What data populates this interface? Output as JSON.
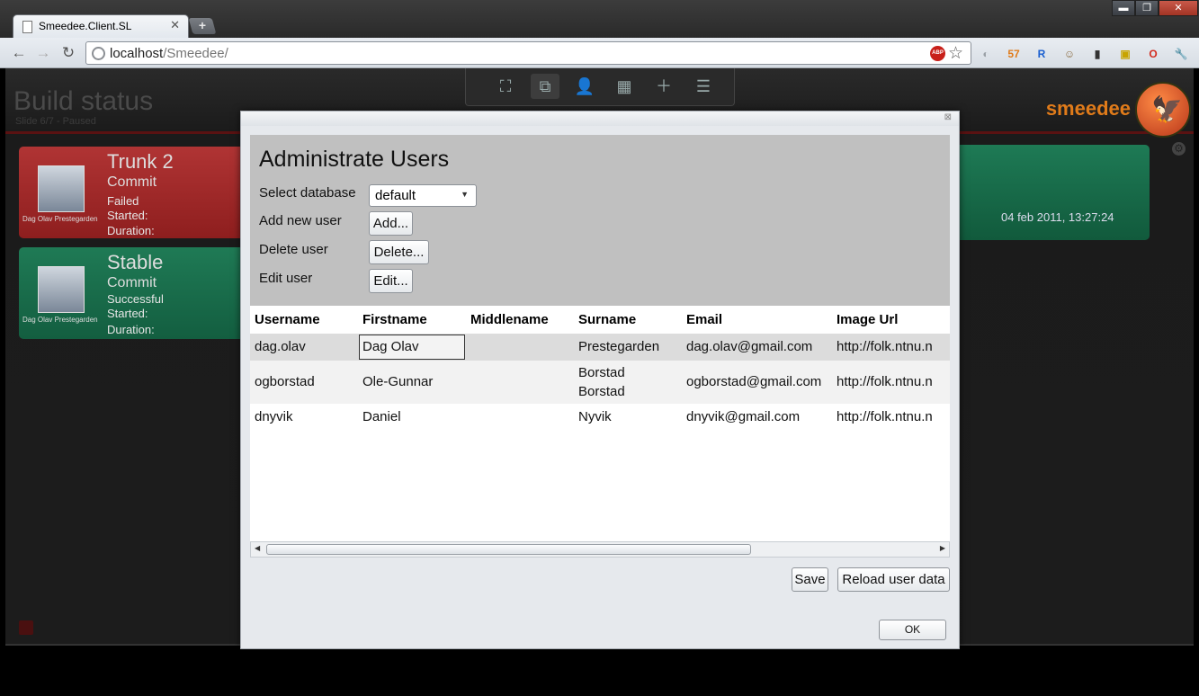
{
  "browser": {
    "tab_title": "Smeedee.Client.SL",
    "tab_close": "✕",
    "new_tab": "+",
    "window_controls": {
      "minimize": "▬",
      "maximize": "❐",
      "close": "✕"
    },
    "nav": {
      "back": "←",
      "forward": "→",
      "reload": "↻"
    },
    "url_host": "localhost",
    "url_path": "/Smeedee/",
    "abp_label": "ABP",
    "star": "☆",
    "extensions": [
      {
        "name": "search-ext-icon",
        "glyph": "◐",
        "color": "#9aa0a6"
      },
      {
        "name": "calendar-ext-icon",
        "glyph": "57",
        "color": "#e07b1a"
      },
      {
        "name": "r-ext-icon",
        "glyph": "R",
        "color": "#1a5fd0"
      },
      {
        "name": "owl-ext-icon",
        "glyph": "☺",
        "color": "#8a6a40"
      },
      {
        "name": "phone-ext-icon",
        "glyph": "▮",
        "color": "#333"
      },
      {
        "name": "sab-ext-icon",
        "glyph": "▣",
        "color": "#c8a400"
      },
      {
        "name": "opera-ext-icon",
        "glyph": "O",
        "color": "#d32b1e"
      },
      {
        "name": "wrench-icon",
        "glyph": "🔧",
        "color": "#555"
      }
    ]
  },
  "app": {
    "title": "Build status",
    "subtitle": "Slide 6/7 - Paused",
    "logo_text": "smeedee",
    "toolbar_icons": [
      {
        "name": "fullscreen-icon",
        "glyph": "⛶"
      },
      {
        "name": "settings-slider-icon",
        "glyph": "⧉"
      },
      {
        "name": "user-add-icon",
        "glyph": "👤"
      },
      {
        "name": "calendar-icon",
        "glyph": "▦"
      },
      {
        "name": "add-slide-icon",
        "glyph": "＋"
      },
      {
        "name": "layout-icon",
        "glyph": "☰"
      }
    ],
    "builds": [
      {
        "name": "Trunk 2",
        "commit": "Commit",
        "status": "Failed",
        "started": "Started:",
        "duration": "Duration:",
        "person": "Dag Olav  Prestegarden",
        "color": "red"
      },
      {
        "name": "Stable",
        "commit": "Commit",
        "status": "Successful",
        "started": "Started:",
        "duration": "Duration:",
        "person": "Dag Olav  Prestegarden",
        "color": "green"
      }
    ],
    "right_card_date": "04 feb 2011, 13:27:24"
  },
  "dialog": {
    "close": "⊠",
    "title": "Administrate Users",
    "select_database_label": "Select database",
    "database_value": "default",
    "add_label": "Add new user",
    "add_button": "Add...",
    "delete_label": "Delete user",
    "delete_button": "Delete...",
    "edit_label": "Edit user",
    "edit_button": "Edit...",
    "columns": [
      "Username",
      "Firstname",
      "Middlename",
      "Surname",
      "Email",
      "Image Url"
    ],
    "rows": [
      {
        "username": "dag.olav",
        "firstname": "Dag Olav",
        "middlename": "",
        "surname": "Prestegarden",
        "surname2": "",
        "email": "dag.olav@gmail.com",
        "image_url": "http://folk.ntnu.n"
      },
      {
        "username": "ogborstad",
        "firstname": "Ole-Gunnar",
        "middlename": "",
        "surname": "Borstad",
        "surname2": "Borstad",
        "email": "ogborstad@gmail.com",
        "image_url": "http://folk.ntnu.n"
      },
      {
        "username": "dnyvik",
        "firstname": "Daniel",
        "middlename": "",
        "surname": "Nyvik",
        "surname2": "",
        "email": "dnyvik@gmail.com",
        "image_url": "http://folk.ntnu.n"
      }
    ],
    "scroll_left": "◀",
    "scroll_right": "▶",
    "save_button": "Save",
    "reload_button": "Reload user data",
    "ok_button": "OK"
  }
}
